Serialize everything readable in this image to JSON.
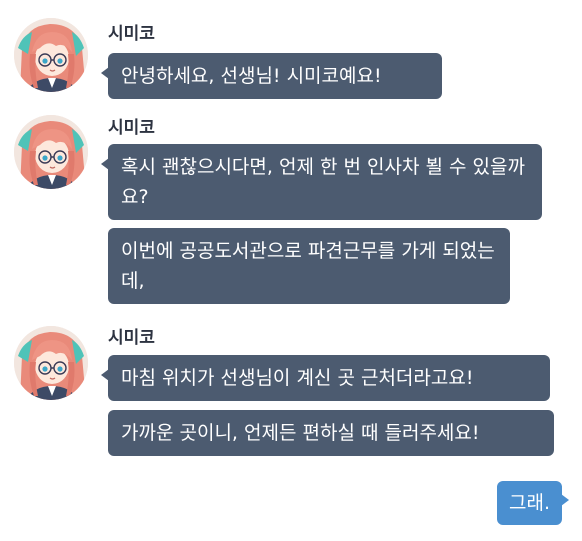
{
  "colors": {
    "incoming_bubble": "#4c5b70",
    "outgoing_bubble": "#4a8fd0",
    "name_text": "#2d3341",
    "background": "#ffffff"
  },
  "groups": [
    {
      "sender": "시미코",
      "avatar": "avatar-icon",
      "messages": [
        "안녕하세요, 선생님! 시미코예요!"
      ]
    },
    {
      "sender": "시미코",
      "avatar": "avatar-icon",
      "messages": [
        "혹시 괜찮으시다면, 언제 한 번 인사차 뵐 수 있을까요?",
        "이번에 공공도서관으로 파견근무를 가게 되었는데,"
      ]
    },
    {
      "sender": "시미코",
      "avatar": "avatar-icon",
      "messages": [
        "마침 위치가 선생님이 계신 곳 근처더라고요!",
        "가까운 곳이니, 언제든 편하실 때 들러주세요!"
      ]
    }
  ],
  "reply": {
    "text": "그래."
  }
}
